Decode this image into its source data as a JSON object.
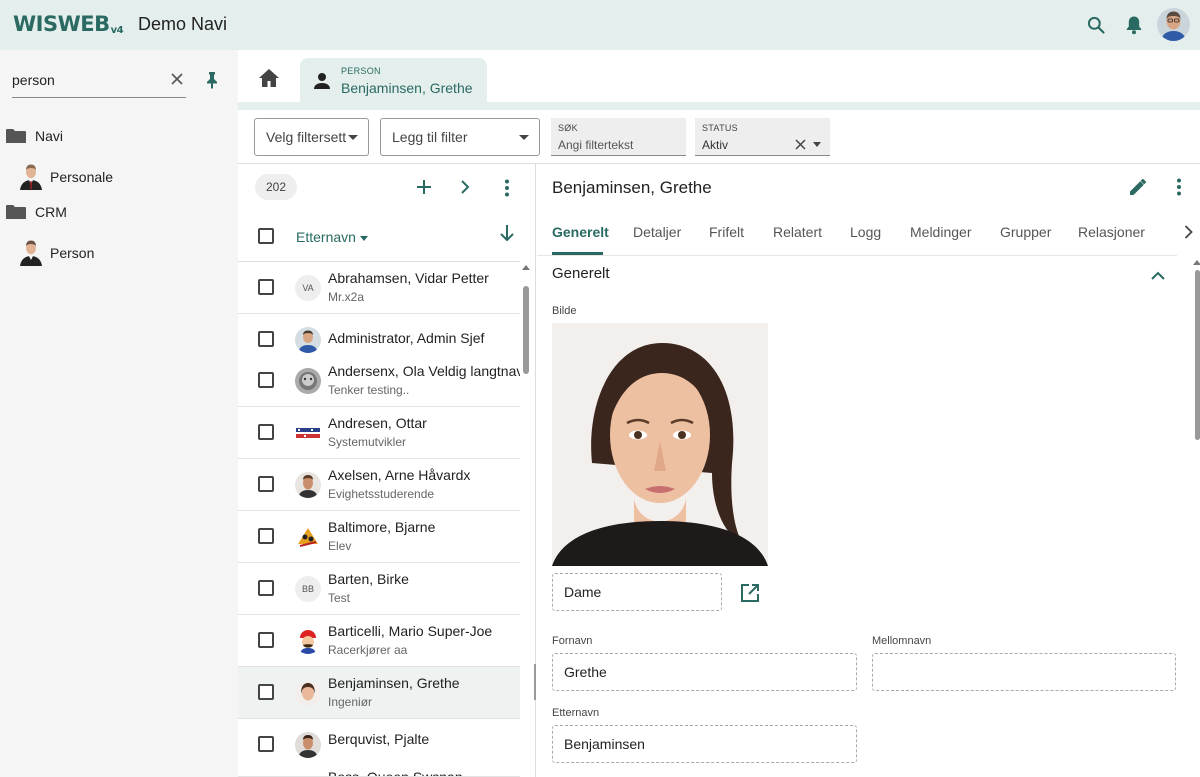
{
  "header": {
    "logo_text": "WISWEB",
    "logo_version": "v4",
    "app_title": "Demo Navi",
    "accent_color": "#2a6a62",
    "icons": [
      "search-icon",
      "bell-icon",
      "user-avatar"
    ]
  },
  "nav": {
    "search_value": "person",
    "tree": [
      {
        "label": "Navi",
        "icon": "folder-icon"
      },
      {
        "label": "Personale",
        "icon": "person-avatar-icon"
      },
      {
        "label": "CRM",
        "icon": "folder-icon"
      },
      {
        "label": "Person",
        "icon": "person-avatar-icon"
      }
    ]
  },
  "tabs": {
    "active": {
      "kind": "PERSON",
      "title": "Benjaminsen, Grethe"
    }
  },
  "filters": {
    "filter_set": "Velg filtersett",
    "add_filter": "Legg til filter",
    "search_label": "SØK",
    "search_placeholder": "Angi filtertekst",
    "status_label": "STATUS",
    "status_value": "Aktiv"
  },
  "list": {
    "count": "202",
    "sort_field": "Etternavn",
    "rows": [
      {
        "name": "Abrahamsen, Vidar Petter",
        "sub": "Mr.x2a",
        "initials": "VA"
      },
      {
        "name": "Administrator, Admin Sjef",
        "sub": "",
        "initials": ""
      },
      {
        "name": "Andersenx, Ola Veldig langtnavnet",
        "sub": "Tenker testing..",
        "initials": ""
      },
      {
        "name": "Andresen, Ottar",
        "sub": "Systemutvikler",
        "initials": ""
      },
      {
        "name": "Axelsen, Arne Håvardx",
        "sub": "Evighetsstuderende",
        "initials": ""
      },
      {
        "name": "Baltimore, Bjarne",
        "sub": "Elev",
        "initials": ""
      },
      {
        "name": "Barten, Birke",
        "sub": "Test",
        "initials": "BB"
      },
      {
        "name": "Barticelli, Mario Super-Joe",
        "sub": "Racerkjører aa",
        "initials": ""
      },
      {
        "name": "Benjaminsen, Grethe",
        "sub": "Ingeniør",
        "initials": ""
      },
      {
        "name": "Berquvist, Pjalte",
        "sub": "",
        "initials": ""
      },
      {
        "name": "Boss, Queen Swsnan",
        "sub": "",
        "initials": ""
      }
    ]
  },
  "detail": {
    "title": "Benjaminsen, Grethe",
    "tabs": [
      "Generelt",
      "Detaljer",
      "Frifelt",
      "Relatert",
      "Logg",
      "Meldinger",
      "Grupper",
      "Relasjoner"
    ],
    "section_title": "Generelt",
    "image_label": "Bilde",
    "image_caption": "Dame",
    "fields": {
      "first_name_label": "Fornavn",
      "first_name_value": "Grethe",
      "middle_name_label": "Mellomnavn",
      "middle_name_value": "",
      "last_name_label": "Etternavn",
      "last_name_value": "Benjaminsen"
    }
  }
}
